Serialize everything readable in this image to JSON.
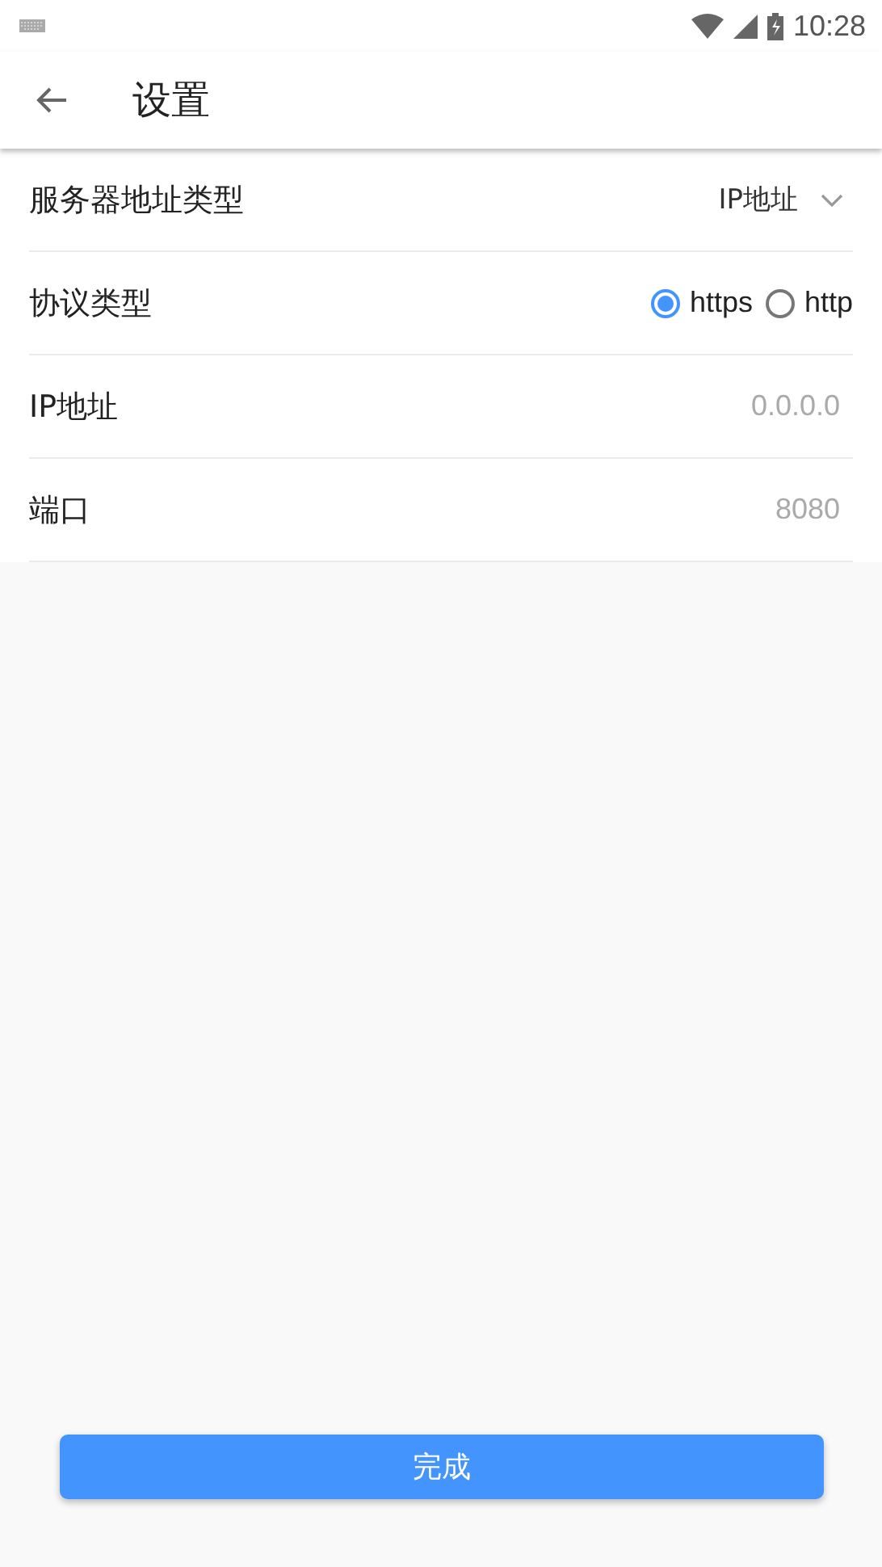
{
  "status_bar": {
    "time": "10:28"
  },
  "toolbar": {
    "title": "设置"
  },
  "rows": [
    {
      "kind": "select",
      "label": "服务器地址类型",
      "value": "IP地址"
    },
    {
      "kind": "radio",
      "label": "协议类型",
      "options": [
        {
          "label": "https",
          "selected": true
        },
        {
          "label": "http",
          "selected": false
        }
      ]
    },
    {
      "kind": "input",
      "label": "IP地址",
      "placeholder": "0.0.0.0"
    },
    {
      "kind": "input",
      "label": "端口",
      "placeholder": "8080"
    }
  ],
  "button": "完成"
}
